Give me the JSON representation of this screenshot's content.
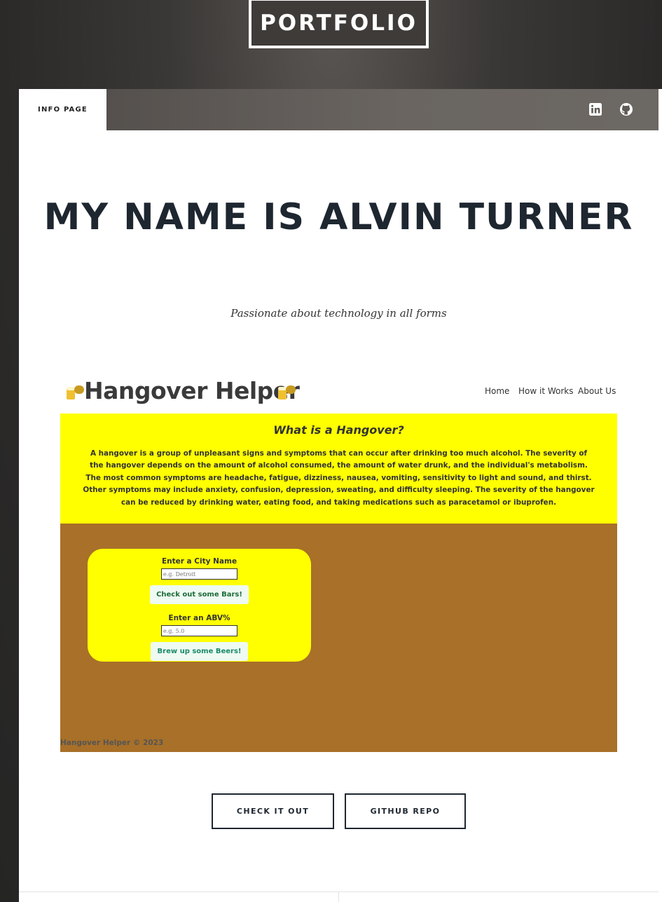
{
  "header": {
    "logo": "PORTFOLIO"
  },
  "nav": {
    "tab": "INFO PAGE",
    "icons": [
      "linkedin-icon",
      "github-icon"
    ]
  },
  "hero": {
    "title": "MY NAME IS ALVIN TURNER",
    "subtitle": "Passionate about technology in all forms"
  },
  "project": {
    "app_title": "Hangover Helper",
    "nav": [
      "Home",
      "How it Works",
      "About Us"
    ],
    "heading": "What is a Hangover?",
    "description": "A hangover is a group of unpleasant signs and symptoms that can occur after drinking too much alcohol. The severity of the hangover depends on the amount of alcohol consumed, the amount of water drunk, and the individual's metabolism. The most common symptoms are headache, fatigue, dizziness, nausea, vomiting, sensitivity to light and sound, and thirst. Other symptoms may include anxiety, confusion, depression, sweating, and difficulty sleeping. The severity of the hangover can be reduced by drinking water, eating food, and taking medications such as paracetamol or ibuprofen.",
    "city_label": "Enter a City Name",
    "city_placeholder": "e.g. Detroit",
    "bars_button": "Check out some Bars!",
    "abv_label": "Enter an ABV%",
    "abv_placeholder": "e.g. 5.0",
    "beers_button": "Brew up some Beers!",
    "footer": "Hangover Helper © 2023",
    "colors": {
      "yellow": "#ffff00",
      "brown": "#a87028"
    }
  },
  "actions": {
    "check_it_out": "CHECK IT OUT",
    "github_repo": "GITHUB REPO"
  }
}
